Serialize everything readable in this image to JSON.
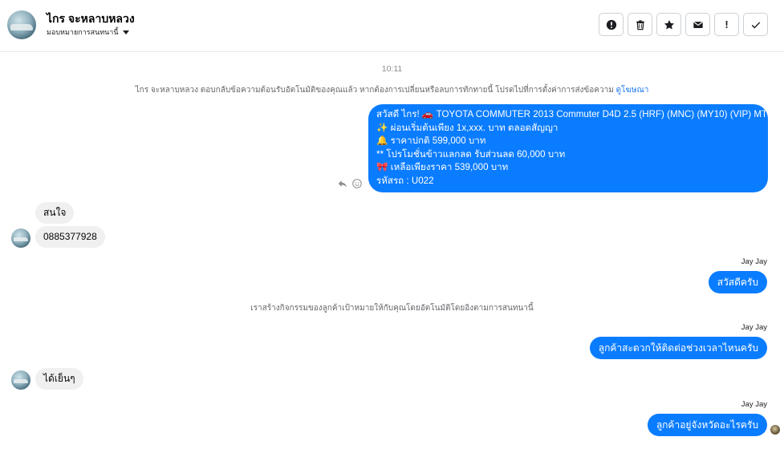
{
  "header": {
    "contact_name": "ไกร จะหลาบหลวง",
    "assign_label": "มอบหมายการสนทนานี้",
    "toolbar": [
      {
        "name": "alert-button",
        "icon": "alert-circle-icon",
        "label": ""
      },
      {
        "name": "delete-button",
        "icon": "trash-icon",
        "label": ""
      },
      {
        "name": "star-button",
        "icon": "star-icon",
        "label": ""
      },
      {
        "name": "mark-unread-button",
        "icon": "envelope-icon",
        "label": ""
      },
      {
        "name": "spam-button",
        "icon": "exclamation-icon",
        "label": "!"
      },
      {
        "name": "done-button",
        "icon": "check-icon",
        "label": ""
      }
    ]
  },
  "chat": {
    "timestamp": "10:11",
    "auto_reply_notice": "ไกร จะหลาบหลวง ตอบกลับข้อความต้อนรับอัตโนมัติของคุณแล้ว หากต้องการเปลี่ยนหรือลบการทักทายนี้ โปรดไปที่การตั้งค่าการส่งข้อความ",
    "auto_reply_link": "ดูโฆษณา",
    "greeting_lines": [
      "สวัสดี ไกร! 🚗  TOYOTA COMMUTER 2013 Commuter D4D 2.5 (HRF) (MNC) (MY10) (VIP) MT",
      "✨  ผ่อนเริ่มต้นเพียง 1x,xxx. บาท ตลอดสัญญา",
      "🔔 ราคาปกติ 599,000 บาท",
      "** โปรโมชั่นข้าวแลกลด รับส่วนลด 60,000 บาท",
      "🎀  เหลือเพียงราคา 539,000 บาท",
      " รหัสรถ : U022"
    ],
    "in_msg_1": "สนใจ",
    "in_msg_2": "0885377928",
    "agent_name": "Jay Jay",
    "out_msg_1": "สวัสดีครับ",
    "system_notice": "เราสร้างกิจกรรมของลูกค้าเป้าหมายให้กับคุณโดยอัตโนมัติโดยอิงตามการสนทนานี้",
    "out_msg_2": "ลูกค้าสะดวกให้ติดต่อช่วงเวลาไหนครับ",
    "in_msg_3": "ได้เย็นๆ",
    "out_msg_3": "ลูกค้าอยู่จังหวัดอะไรครับ"
  },
  "colors": {
    "outgoing_bubble": "#0a7cff",
    "incoming_bubble": "#f0f0f0",
    "link": "#1877f2"
  }
}
